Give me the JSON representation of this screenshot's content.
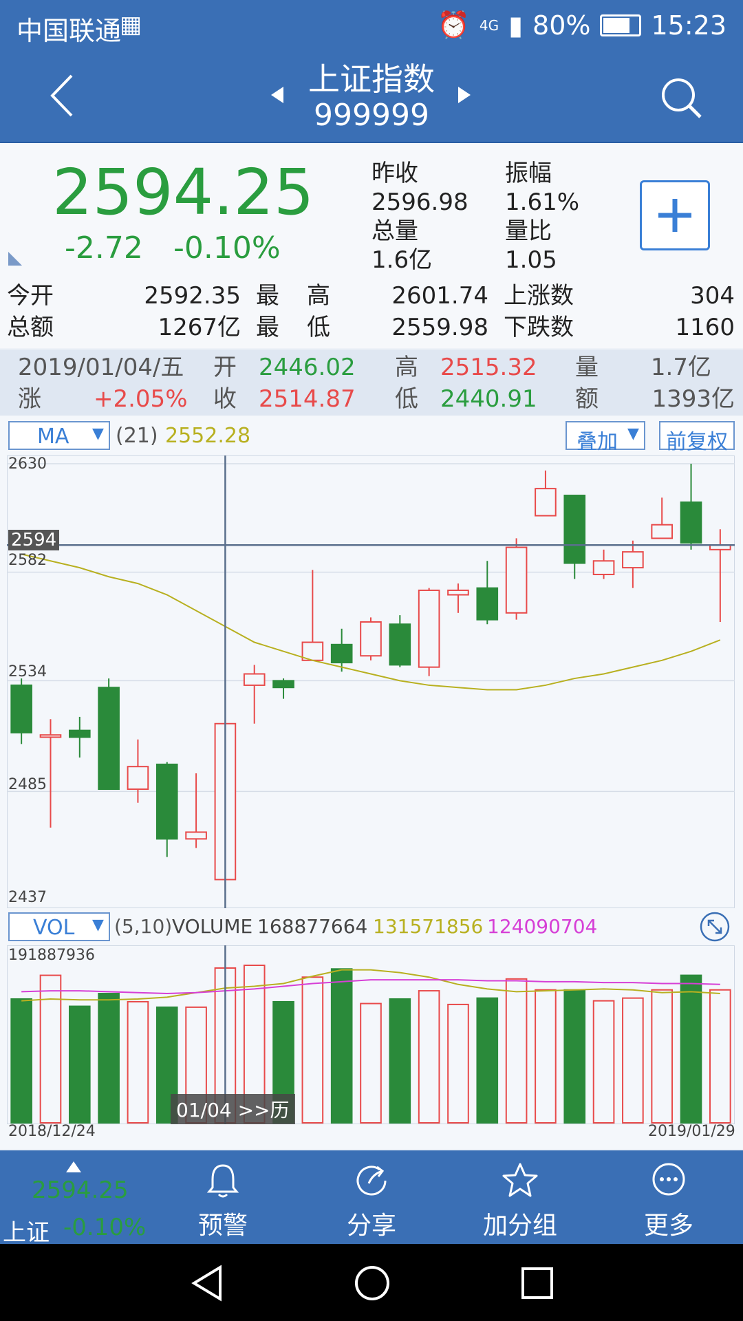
{
  "status": {
    "carrier": "中国联通",
    "signal": "4G",
    "battery": "80%",
    "time": "15:23"
  },
  "header": {
    "title": "上证指数",
    "code": "999999"
  },
  "quote": {
    "price": "2594.25",
    "change": "-2.72",
    "change_pct": "-0.10%",
    "prev_close_label": "昨收",
    "prev_close": "2596.98",
    "amplitude_label": "振幅",
    "amplitude": "1.61%",
    "volume_label": "总量",
    "volume": "1.6亿",
    "vol_ratio_label": "量比",
    "vol_ratio": "1.05",
    "open_label": "今开",
    "open": "2592.35",
    "high_label1": "最",
    "high_label2": "高",
    "high": "2601.74",
    "up_count_label": "上涨数",
    "up_count": "304",
    "amount_label": "总额",
    "amount": "1267亿",
    "low_label1": "最",
    "low_label2": "低",
    "low": "2559.98",
    "down_count_label": "下跌数",
    "down_count": "1160"
  },
  "history": {
    "date": "2019/01/04/五",
    "open_label": "开",
    "open": "2446.02",
    "high_label": "高",
    "high": "2515.32",
    "vol_label": "量",
    "vol": "1.7亿",
    "chg_label": "涨",
    "chg": "+2.05%",
    "close_label": "收",
    "close": "2514.87",
    "low_label": "低",
    "low": "2440.91",
    "amt_label": "额",
    "amt": "1393亿"
  },
  "ma_bar": {
    "indicator": "MA",
    "param": "(21)",
    "value": "2552.28",
    "overlay": "叠加",
    "adjust": "前复权"
  },
  "price_axis": {
    "labels": [
      "2630",
      "2582",
      "2534",
      "2485",
      "2437"
    ],
    "cursor": "2594"
  },
  "vol_bar": {
    "indicator": "VOL",
    "param": "(5,10)",
    "name": "VOLUME",
    "v1": "168877664",
    "v2": "131571856",
    "v3": "124090704",
    "max": "191887936"
  },
  "date_axis": {
    "start": "2018/12/24",
    "end": "2019/01/29",
    "tip": "01/04 >>历"
  },
  "nav": {
    "mini_price": "2594.25",
    "mini_name": "上证",
    "mini_pct": "-0.10%",
    "items": [
      {
        "label": "预警"
      },
      {
        "label": "分享"
      },
      {
        "label": "加分组"
      },
      {
        "label": "更多"
      }
    ]
  },
  "colors": {
    "up": "#e84a4a",
    "down": "#2a8a3a",
    "ma": "#b8b020",
    "ma10": "#d63fd6",
    "header": "#3a6fb5"
  },
  "chart_data": {
    "type": "candlestick",
    "ylim": [
      2437,
      2630
    ],
    "candles": [
      {
        "o": 2532,
        "c": 2511,
        "h": 2535,
        "l": 2506
      },
      {
        "o": 2509,
        "c": 2510,
        "h": 2517,
        "l": 2469
      },
      {
        "o": 2512,
        "c": 2509,
        "h": 2518,
        "l": 2500
      },
      {
        "o": 2531,
        "c": 2486,
        "h": 2535,
        "l": 2486
      },
      {
        "o": 2486,
        "c": 2496,
        "h": 2508,
        "l": 2480
      },
      {
        "o": 2497,
        "c": 2464,
        "h": 2498,
        "l": 2456
      },
      {
        "o": 2464,
        "c": 2467,
        "h": 2493,
        "l": 2460
      },
      {
        "o": 2446,
        "c": 2515,
        "h": 2515,
        "l": 2441
      },
      {
        "o": 2532,
        "c": 2537,
        "h": 2541,
        "l": 2515
      },
      {
        "o": 2534,
        "c": 2531,
        "h": 2535,
        "l": 2526
      },
      {
        "o": 2543,
        "c": 2551,
        "h": 2583,
        "l": 2543
      },
      {
        "o": 2550,
        "c": 2542,
        "h": 2557,
        "l": 2538
      },
      {
        "o": 2545,
        "c": 2560,
        "h": 2562,
        "l": 2543
      },
      {
        "o": 2559,
        "c": 2541,
        "h": 2563,
        "l": 2540
      },
      {
        "o": 2540,
        "c": 2574,
        "h": 2575,
        "l": 2536
      },
      {
        "o": 2572,
        "c": 2574,
        "h": 2577,
        "l": 2564
      },
      {
        "o": 2575,
        "c": 2561,
        "h": 2587,
        "l": 2559
      },
      {
        "o": 2564,
        "c": 2593,
        "h": 2597,
        "l": 2561
      },
      {
        "o": 2607,
        "c": 2619,
        "h": 2627,
        "l": 2607
      },
      {
        "o": 2616,
        "c": 2586,
        "h": 2616,
        "l": 2579
      },
      {
        "o": 2581,
        "c": 2587,
        "h": 2592,
        "l": 2579
      },
      {
        "o": 2584,
        "c": 2591,
        "h": 2596,
        "l": 2575
      },
      {
        "o": 2597,
        "c": 2603,
        "h": 2615,
        "l": 2597
      },
      {
        "o": 2613,
        "c": 2595,
        "h": 2630,
        "l": 2592
      },
      {
        "o": 2592,
        "c": 2594,
        "h": 2601,
        "l": 2560
      }
    ],
    "ma21": [
      2590,
      2587,
      2584,
      2580,
      2577,
      2572,
      2565,
      2558,
      2551,
      2547,
      2543,
      2540,
      2537,
      2534,
      2532,
      2531,
      2530,
      2530,
      2532,
      2535,
      2537,
      2540,
      2543,
      2547,
      2552
    ],
    "volumes": [
      136,
      162,
      128,
      142,
      133,
      127,
      127,
      170,
      173,
      133,
      160,
      169,
      131,
      136,
      145,
      130,
      137,
      158,
      146,
      146,
      134,
      137,
      146,
      162,
      146
    ],
    "vol_ma5": [
      134,
      136,
      135,
      135,
      136,
      138,
      143,
      148,
      150,
      153,
      161,
      168,
      168,
      165,
      160,
      152,
      147,
      144,
      145,
      146,
      147,
      146,
      143,
      144,
      142
    ],
    "vol_ma10": [
      144,
      145,
      145,
      144,
      143,
      142,
      143,
      145,
      147,
      150,
      153,
      155,
      157,
      157,
      157,
      157,
      156,
      156,
      155,
      155,
      154,
      154,
      153,
      153,
      152
    ],
    "vol_max": 191887936
  }
}
